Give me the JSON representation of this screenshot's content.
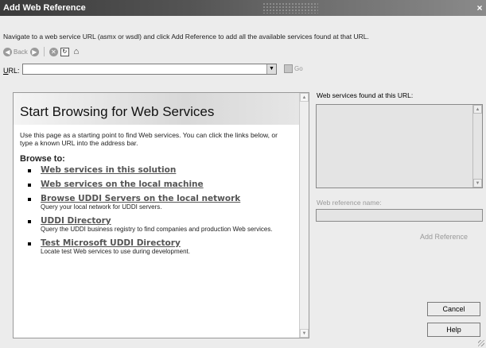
{
  "window": {
    "title": "Add Web Reference",
    "close_glyph": "×"
  },
  "instructions": "Navigate to a web service URL (asmx or wsdl) and click Add Reference to add all the available services found at that URL.",
  "toolbar": {
    "back_label": "Back"
  },
  "url": {
    "label_underlined": "U",
    "label_rest": "RL:",
    "value": "",
    "go_label": "Go"
  },
  "browser": {
    "heading": "Start Browsing for Web Services",
    "intro": "Use this page as a starting point to find Web services. You can click the links below, or type a known URL into the address bar.",
    "browse_to": "Browse to:",
    "links": [
      {
        "label": "Web services in this solution",
        "desc": ""
      },
      {
        "label": "Web services on the local machine",
        "desc": ""
      },
      {
        "label": "Browse UDDI Servers on the local network",
        "desc": "Query your local network for UDDI servers."
      },
      {
        "label": "UDDI Directory",
        "desc": "Query the UDDI business registry to find companies and production Web services."
      },
      {
        "label": "Test Microsoft UDDI Directory",
        "desc": "Locate test Web services to use during development."
      }
    ]
  },
  "right_panel": {
    "found_label": "Web services found at this URL:",
    "ref_name_label": "Web reference name:",
    "add_reference": "Add Reference"
  },
  "buttons": {
    "cancel": "Cancel",
    "help": "Help"
  },
  "icons": [
    "back-icon",
    "forward-icon",
    "stop-icon",
    "refresh-icon",
    "home-icon",
    "go-icon",
    "dropdown-icon"
  ]
}
